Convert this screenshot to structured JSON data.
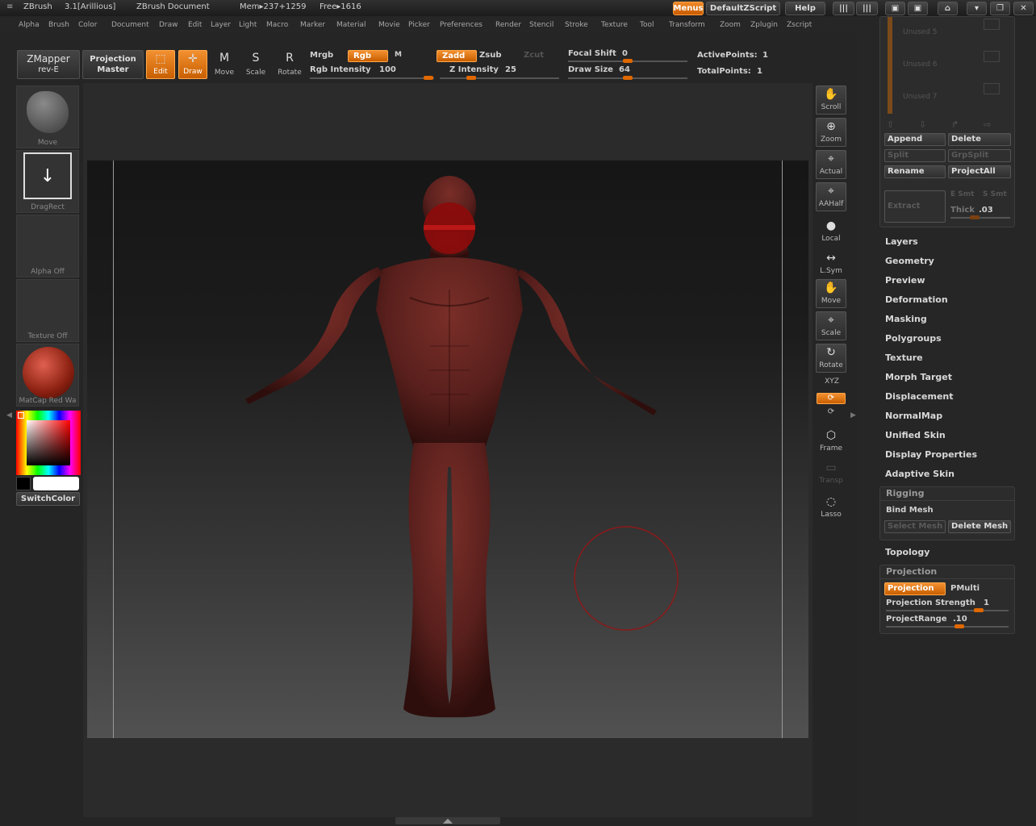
{
  "titlebar": {
    "app_name": "ZBrush",
    "version": "3.1[Arillious]",
    "document": "ZBrush Document",
    "mem": "Mem▸237+1259",
    "free": "Free▸1616",
    "menus_label": "Menus",
    "script_label": "DefaultZScript",
    "help_label": "Help"
  },
  "menu": [
    "Alpha",
    "Brush",
    "Color",
    "Document",
    "Draw",
    "Edit",
    "Layer",
    "Light",
    "Macro",
    "Marker",
    "Material",
    "Movie",
    "Picker",
    "Preferences",
    "Render",
    "Stencil",
    "Stroke",
    "Texture",
    "Tool",
    "Transform",
    "Zoom",
    "Zplugin",
    "Zscript"
  ],
  "toolbar": {
    "zmapper_label": "ZMapper",
    "zmapper_sub": "rev-E",
    "projection_master_line1": "Projection",
    "projection_master_line2": "Master",
    "edit": "Edit",
    "draw": "Draw",
    "move": "Move",
    "scale": "Scale",
    "rotate": "Rotate",
    "mrgb": "Mrgb",
    "rgb": "Rgb",
    "m": "M",
    "rgb_intensity_label": "Rgb Intensity",
    "rgb_intensity_value": "100",
    "zadd": "Zadd",
    "zsub": "Zsub",
    "zcut": "Zcut",
    "z_intensity_label": "Z Intensity",
    "z_intensity_value": "25",
    "focal_shift_label": "Focal Shift",
    "focal_shift_value": "0",
    "draw_size_label": "Draw Size",
    "draw_size_value": "64",
    "active_points_label": "ActivePoints:",
    "active_points_value": "1",
    "total_points_label": "TotalPoints:",
    "total_points_value": "1"
  },
  "left": {
    "brush_caption": "Move",
    "stroke_caption": "DragRect",
    "alpha_caption": "Alpha  Off",
    "texture_caption": "Texture  Off",
    "material_caption": "MatCap  Red  Wa",
    "switch_color": "SwitchColor"
  },
  "right_tools": [
    {
      "name": "scroll",
      "label": "Scroll",
      "icon": "✋"
    },
    {
      "name": "zoom",
      "label": "Zoom",
      "icon": "⊕"
    },
    {
      "name": "actual",
      "label": "Actual",
      "icon": "⌖"
    },
    {
      "name": "aahalf",
      "label": "AAHalf",
      "icon": "⌖"
    },
    {
      "name": "local",
      "label": "Local",
      "icon": "●"
    },
    {
      "name": "lsym",
      "label": "L.Sym",
      "icon": "↔"
    },
    {
      "name": "move",
      "label": "Move",
      "icon": "✋"
    },
    {
      "name": "scale",
      "label": "Scale",
      "icon": "⌖"
    },
    {
      "name": "rotate",
      "label": "Rotate",
      "icon": "↻"
    }
  ],
  "right_tools2": {
    "xyz": "XYZ",
    "frame": "Frame",
    "transp": "Transp",
    "lasso": "Lasso"
  },
  "subtool": {
    "unused5": "Unused  5",
    "unused6": "Unused  6",
    "unused7": "Unused  7",
    "append": "Append",
    "delete": "Delete",
    "split": "Split",
    "grpsplit": "GrpSplit",
    "rename": "Rename",
    "projectall": "ProjectAll",
    "extract": "Extract",
    "e_smt": "E Smt",
    "s_smt": "S Smt",
    "thick_label": "Thick",
    "thick_value": ".03"
  },
  "sections": [
    "Layers",
    "Geometry",
    "Preview",
    "Deformation",
    "Masking",
    "Polygroups",
    "Texture",
    "Morph Target",
    "Displacement",
    "NormalMap",
    "Unified Skin",
    "Display Properties",
    "Adaptive Skin"
  ],
  "rigging": {
    "title": "Rigging",
    "bind_mesh": "Bind Mesh",
    "select_mesh": "Select Mesh",
    "delete_mesh": "Delete Mesh"
  },
  "topology": "Topology",
  "projection": {
    "title": "Projection",
    "projection_btn": "Projection",
    "pmulti": "PMulti",
    "strength_label": "Projection Strength",
    "strength_value": "1",
    "range_label": "ProjectRange",
    "range_value": ".10"
  },
  "colors": {
    "accent": "#e67300",
    "model": "#5a2220",
    "background": "#252525"
  }
}
